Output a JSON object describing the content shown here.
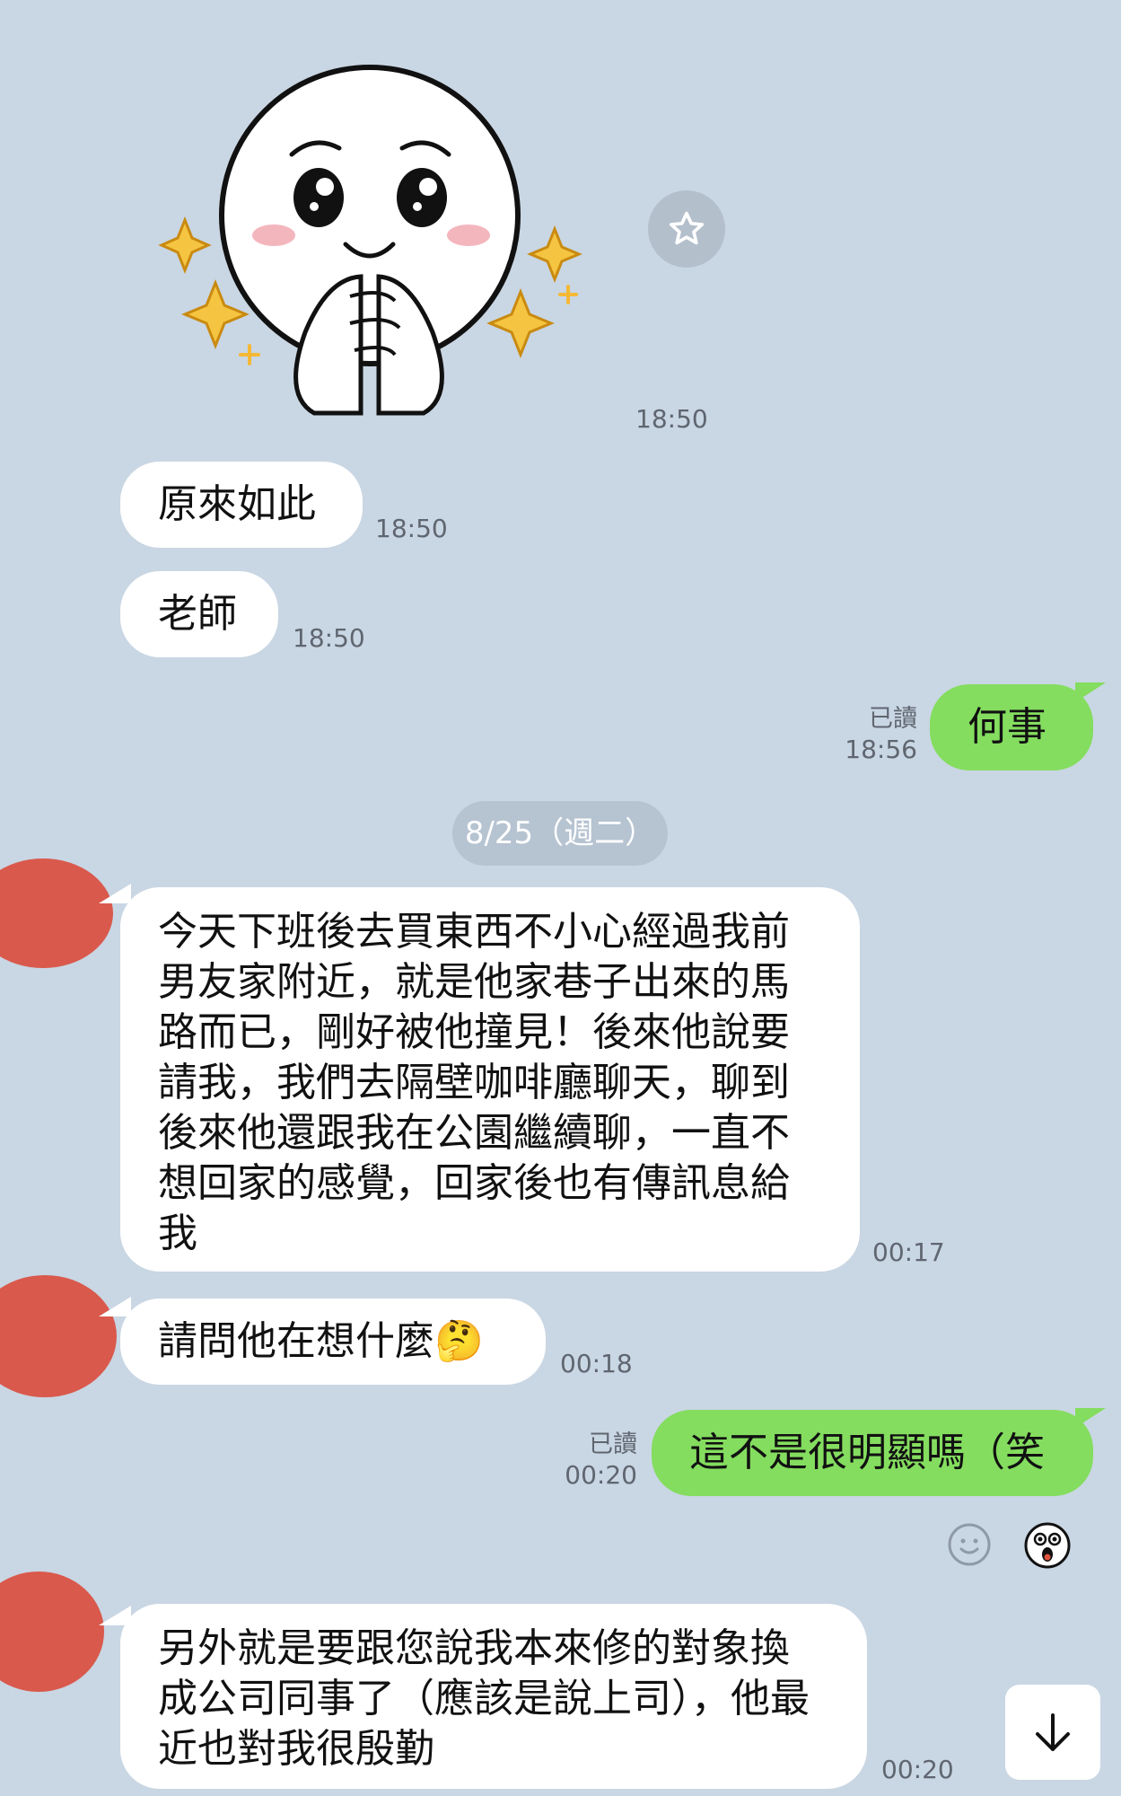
{
  "messages": [
    {
      "id": "sticker",
      "sender": "them",
      "type": "sticker",
      "sticker": "crying-face-sticker",
      "time": "18:50"
    },
    {
      "id": "m1",
      "sender": "them",
      "text": "原來如此",
      "time": "18:50"
    },
    {
      "id": "m2",
      "sender": "them",
      "text": "老師",
      "time": "18:50"
    },
    {
      "id": "m3",
      "sender": "me",
      "text": "何事",
      "read": "已讀",
      "time": "18:56"
    },
    {
      "id": "m4",
      "sender": "them",
      "text": "今天下班後去買東西不小心經過我前\n男友家附近，就是他家巷子出來的馬\n路而已，剛好被他撞見！後來他說要\n請我，我們去隔壁咖啡廳聊天，聊到\n後來他還跟我在公園繼續聊，一直不\n想回家的感覺，回家後也有傳訊息給\n我",
      "time": "00:17"
    },
    {
      "id": "m5",
      "sender": "them",
      "text": "請問他在想什麼🤔",
      "time": "00:18"
    },
    {
      "id": "m6",
      "sender": "me",
      "text": "這不是很明顯嗎（笑",
      "read": "已讀",
      "time": "00:20"
    },
    {
      "id": "m7",
      "sender": "them",
      "text": "另外就是要跟您說我本來修的對象換\n成公司同事了（應該是說上司），他最\n近也對我很殷勤",
      "time": "00:20"
    }
  ],
  "date_divider": "8/25（週二）",
  "icons": {
    "favorite": "star-icon",
    "react": "smiley-icon",
    "reaction": "shocked-face-icon",
    "scroll": "arrow-down-icon"
  },
  "colors": {
    "background": "#c9d6e3",
    "my_bubble": "#84dd5f",
    "their_bubble": "#ffffff",
    "avatar": "#d9594c"
  }
}
